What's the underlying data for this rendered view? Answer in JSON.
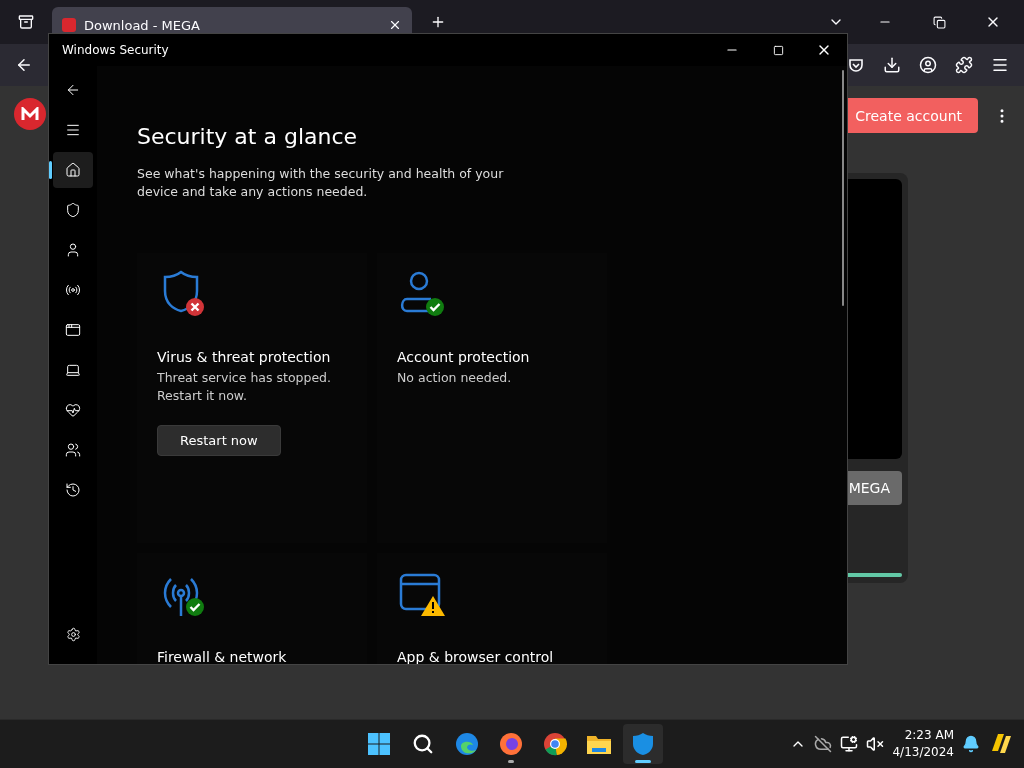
{
  "browser": {
    "tab": {
      "title": "Download - MEGA",
      "selected": true
    },
    "page": {
      "create_account": "Create account",
      "card_button": "MEGA",
      "progress": {
        "level": 1
      }
    }
  },
  "security_window": {
    "title": "Windows Security",
    "nav": [
      {
        "kind": "home",
        "selected": true
      },
      {
        "kind": "shield",
        "selected": false
      },
      {
        "kind": "account",
        "selected": false
      },
      {
        "kind": "network",
        "selected": false
      },
      {
        "kind": "app",
        "selected": false
      },
      {
        "kind": "device",
        "selected": false
      },
      {
        "kind": "health",
        "selected": false
      },
      {
        "kind": "family",
        "selected": false
      },
      {
        "kind": "history",
        "selected": false
      }
    ],
    "heading": "Security at a glance",
    "intro": "See what's happening with the security and health of your device and take any actions needed.",
    "cards": [
      {
        "kind": "shield",
        "badge": {
          "kind": "error"
        },
        "title": "Virus & threat protection",
        "description": "Threat service has stopped. Restart it now.",
        "button": "Restart now"
      },
      {
        "kind": "account",
        "badge": {
          "kind": "ok"
        },
        "title": "Account protection",
        "description": "No action needed."
      },
      {
        "kind": "network",
        "badge": {
          "kind": "ok"
        },
        "title": "Firewall & network"
      },
      {
        "kind": "app",
        "badge": {
          "kind": "warning"
        },
        "title": "App & browser control"
      }
    ]
  },
  "taskbar": {
    "apps": [
      {
        "kind": "start",
        "open": false,
        "selected": false
      },
      {
        "kind": "search",
        "open": false,
        "selected": false
      },
      {
        "kind": "edge",
        "open": false,
        "selected": false
      },
      {
        "kind": "firefox",
        "open": true,
        "selected": false
      },
      {
        "kind": "chrome",
        "open": false,
        "selected": false
      },
      {
        "kind": "explorer",
        "open": false,
        "selected": false
      },
      {
        "kind": "security",
        "open": true,
        "selected": true
      }
    ],
    "time": "2:23 AM",
    "date": "4/13/2024"
  }
}
